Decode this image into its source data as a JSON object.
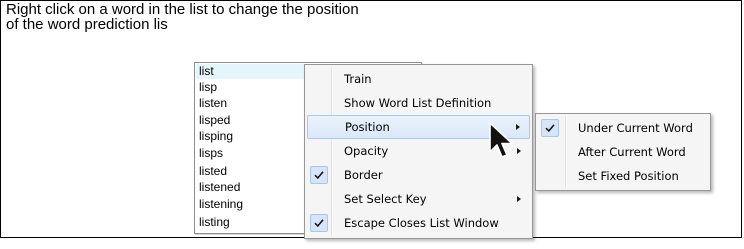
{
  "instruction": {
    "line1": "Right click on a word in the list to change the position",
    "line2": "of the word prediction lis"
  },
  "word_list": {
    "items": [
      "list",
      "lisp",
      "listen",
      "lisped",
      "lisping",
      "lisps",
      "listed",
      "listened",
      "listening",
      "listing"
    ],
    "selected_index": 0
  },
  "context_menu": {
    "items": [
      {
        "label": "Train",
        "checked": false,
        "has_submenu": false
      },
      {
        "label": "Show Word List Definition",
        "checked": false,
        "has_submenu": false
      },
      {
        "label": "Position",
        "checked": false,
        "has_submenu": true
      },
      {
        "label": "Opacity",
        "checked": false,
        "has_submenu": true
      },
      {
        "label": "Border",
        "checked": true,
        "has_submenu": false
      },
      {
        "label": "Set Select Key",
        "checked": false,
        "has_submenu": true
      },
      {
        "label": "Escape Closes List Window",
        "checked": true,
        "has_submenu": false
      }
    ],
    "highlighted": "Position"
  },
  "position_submenu": {
    "items": [
      {
        "label": "Under Current Word",
        "checked": true
      },
      {
        "label": "After Current Word",
        "checked": false
      },
      {
        "label": "Set Fixed Position",
        "checked": false
      }
    ]
  },
  "colors": {
    "highlight": "#dbe8f9",
    "selected_word": "#e6f5fb",
    "check_bg": "#d6e6f8"
  }
}
